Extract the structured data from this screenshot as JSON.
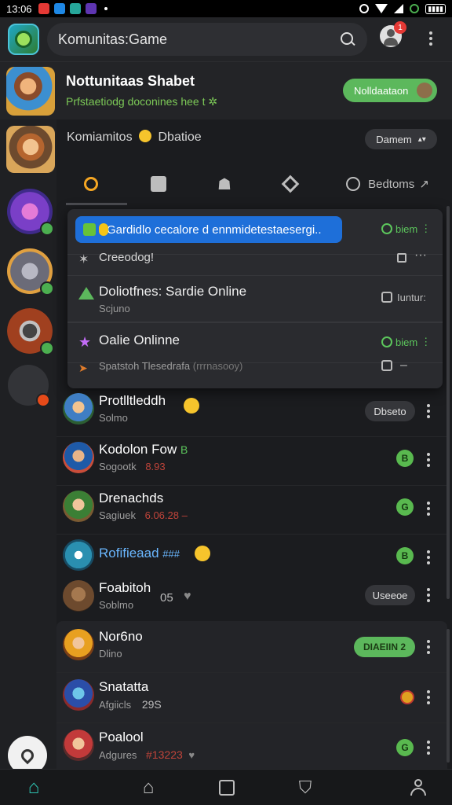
{
  "status_bar": {
    "time": "13:06"
  },
  "header": {
    "title": "Komunitas:Game",
    "notification_count": "1"
  },
  "banner": {
    "title": "Nottunitaas Shabet",
    "subtitle": "Prfstaetiodg doconines hee t ✲",
    "action_label": "Nolldaataon"
  },
  "community": {
    "name": "Komiamitos",
    "suffix": "Dbatioe",
    "button_label": "Damem"
  },
  "tabs": [
    {
      "label": ""
    },
    {
      "label": ""
    },
    {
      "label": ""
    },
    {
      "label": ""
    },
    {
      "label": "Bedtoms"
    }
  ],
  "panel": {
    "search_text": "Gardidlo cecalore d ennmidetestaesergi..",
    "search_status": "biem",
    "rows": [
      {
        "title": "Creeodog!",
        "sub": "",
        "status": ""
      },
      {
        "title": "Doliotfnes: Sardie Online",
        "sub": "Scjuno",
        "status": "Iuntur:"
      },
      {
        "title": "Oalie Onlinne",
        "sub": "",
        "status": "biem"
      },
      {
        "title": "Spatstoh Tlesedrafa",
        "sub": "",
        "status": "–"
      }
    ],
    "paren_text": "(rrrnasooy)"
  },
  "games": [
    {
      "name": "Protlltleddh",
      "sub": "Solmo",
      "action": "Dbseto"
    },
    {
      "name": "Kodolon Fow",
      "suffix": "B",
      "sub": "Sogootk",
      "extra": "8.93",
      "badge": "B"
    },
    {
      "name": "Drenachds",
      "sub": "Sagiuek",
      "extra": "6.06.28 –",
      "badge": "G"
    },
    {
      "name": "Rofifieaad",
      "suffix": "###",
      "sub": "",
      "badge": "B"
    },
    {
      "name": "Foabitoh",
      "sub": "Soblmo",
      "extra": "05",
      "action": "Useeoe"
    }
  ],
  "games2": [
    {
      "name": "Nor6no",
      "sub": "Dlino",
      "action": "DIAEIIN 2"
    },
    {
      "name": "Snatatta",
      "sub": "Afgiicls",
      "extra": "29S"
    },
    {
      "name": "Poalool",
      "sub": "Adgures",
      "extra": "#13223",
      "badge": "G"
    }
  ],
  "colors": {
    "accent_green": "#5cb85c",
    "search_blue": "#1e6fd9",
    "tab_active": "#f5a623"
  }
}
